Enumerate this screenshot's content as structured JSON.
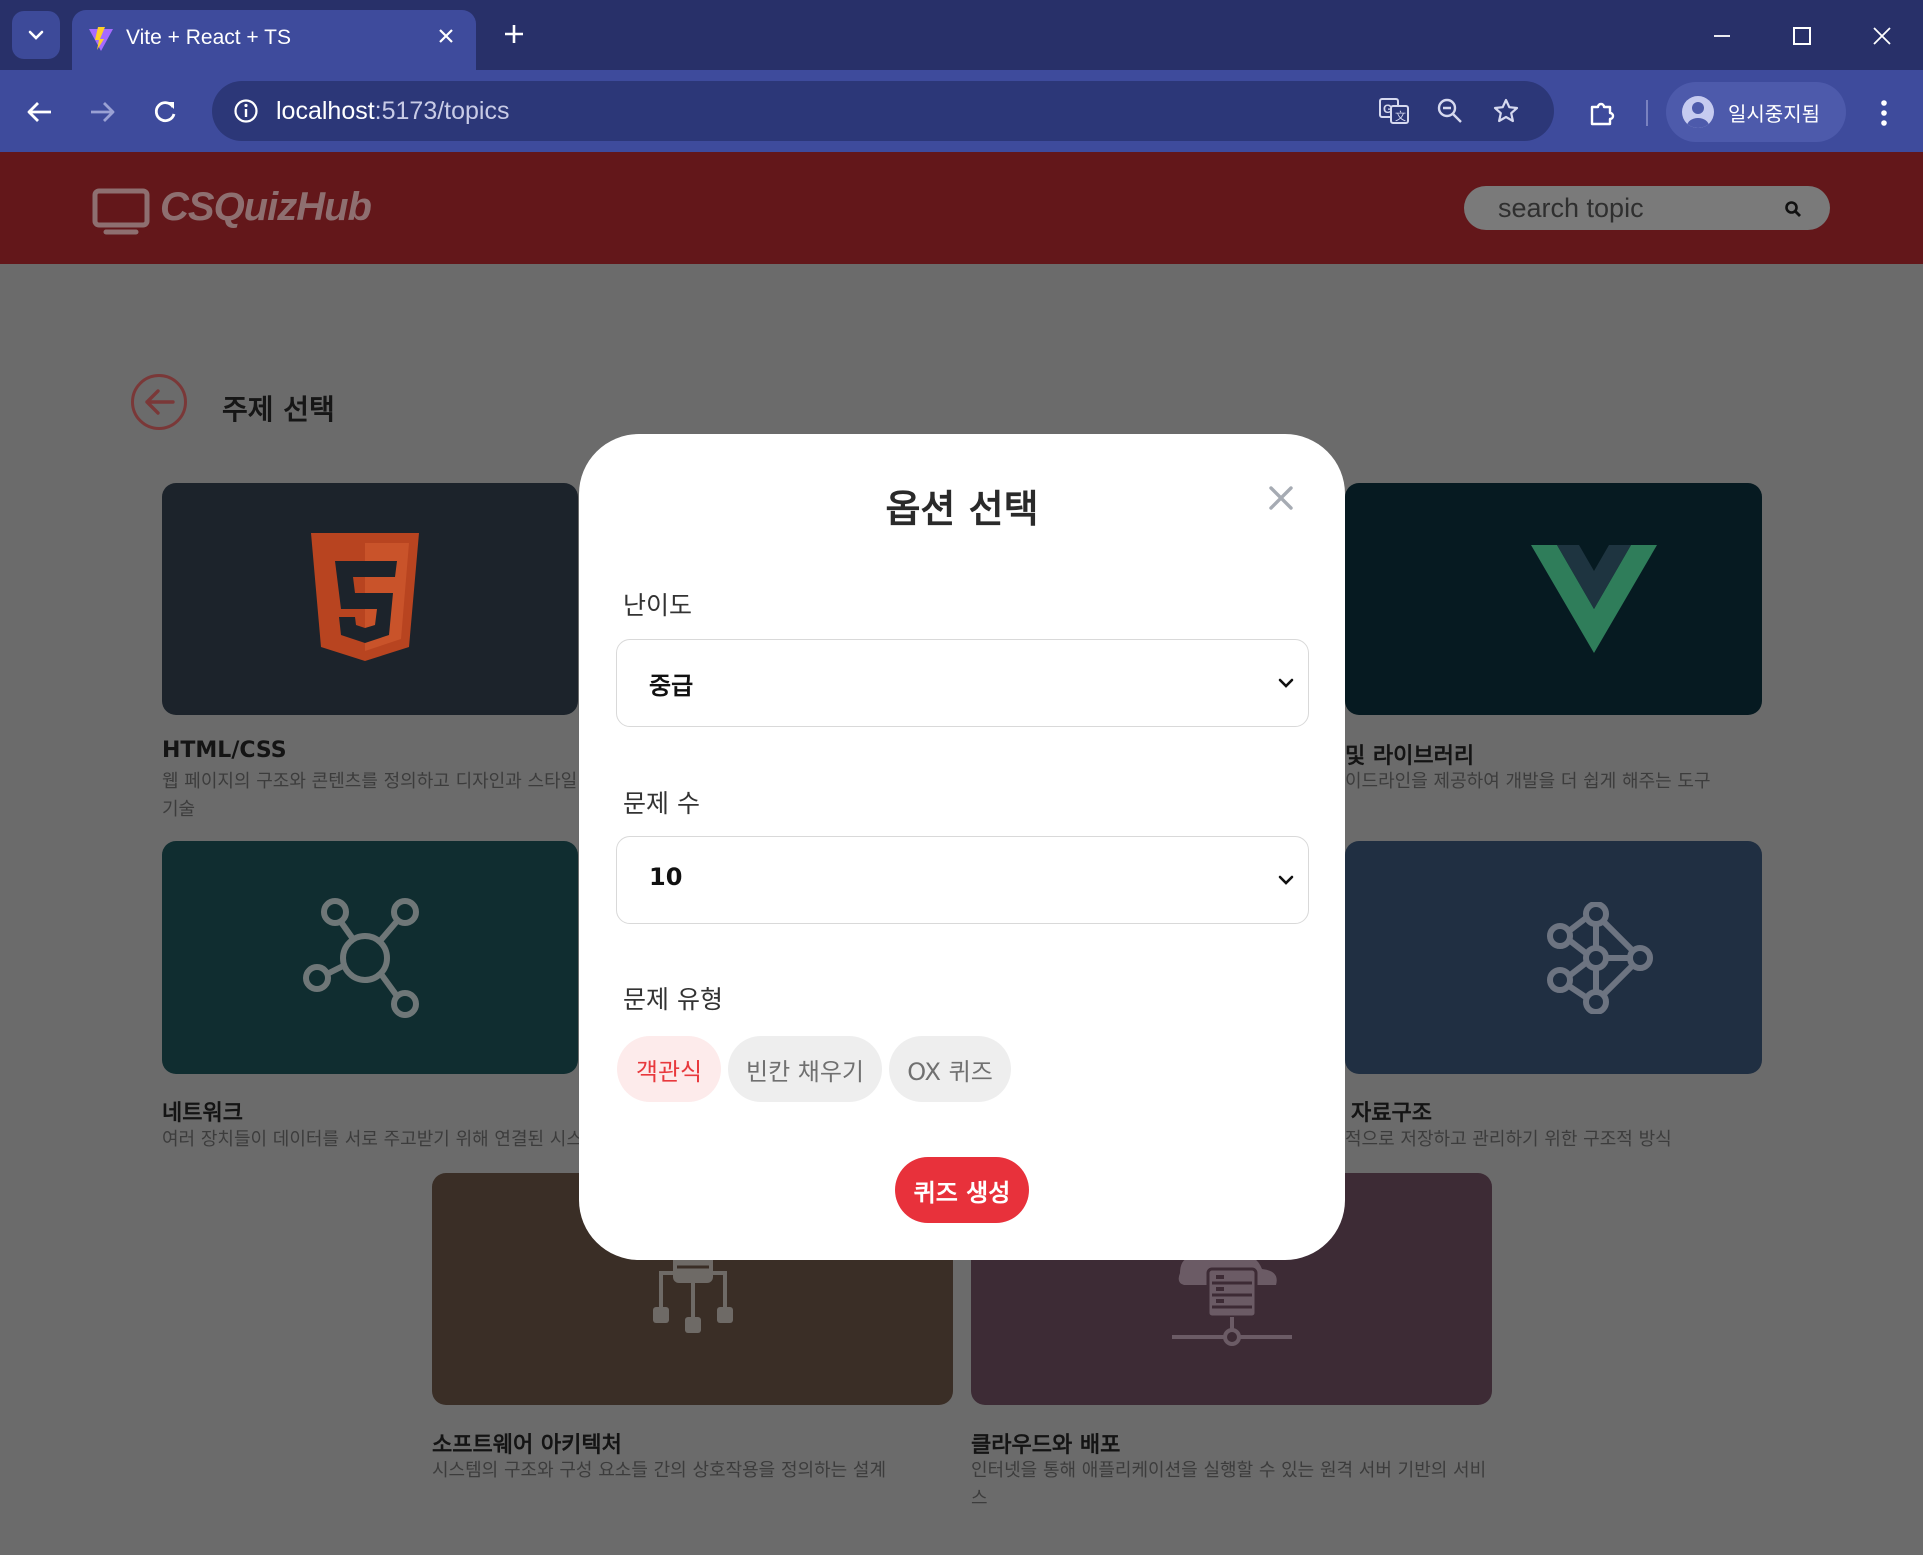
{
  "browser": {
    "tab_title": "Vite + React + TS",
    "url_host": "localhost",
    "url_rest": ":5173/topics",
    "profile_label": "일시중지됨"
  },
  "header": {
    "logo_text": "CSQuizHub",
    "search_placeholder": "search topic",
    "brand_color": "#63171a"
  },
  "page": {
    "title": "주제 선택"
  },
  "cards": [
    {
      "title": "HTML/CSS",
      "desc": "웹 페이지의 구조와 콘텐츠를 정의하고 디자인과 스타일",
      "desc2": "기술",
      "icon": "html5-icon",
      "bg": "#1c232b"
    },
    {
      "title": "및 라이브러리",
      "desc": "이드라인을 제공하여 개발을 더 쉽게 해주는 도구",
      "desc2": "",
      "icon": "vue-icon",
      "bg": "#061a21"
    },
    {
      "title": "네트워크",
      "desc": "여러 장치들이 데이터를 서로 주고받기 위해 연결된 시스",
      "desc2": "",
      "icon": "network-icon",
      "bg": "#102d30"
    },
    {
      "title": "자료구조",
      "desc": "적으로 저장하고 관리하기 위한 구조적 방식",
      "desc2": "",
      "icon": "data-structure-icon",
      "bg": "#202f42"
    },
    {
      "title": "소프트웨어 아키텍처",
      "desc": "시스템의 구조와 구성 요소들 간의 상호작용을 정의하는 설계",
      "desc2": "",
      "icon": "architecture-icon",
      "bg": "#3a2e26"
    },
    {
      "title": "클라우드와 배포",
      "desc": "인터넷을 통해 애플리케이션을 실행할 수 있는 원격 서버 기반의 서비",
      "desc2": "스",
      "icon": "cloud-server-icon",
      "bg": "#3d2b35"
    }
  ],
  "modal": {
    "title": "옵션 선택",
    "difficulty_label": "난이도",
    "difficulty_value": "중급",
    "count_label": "문제 수",
    "count_value": "10",
    "type_label": "문제 유형",
    "types": [
      "객관식",
      "빈칸 채우기",
      "OX 퀴즈"
    ],
    "selected_type": "객관식",
    "submit_label": "퀴즈 생성",
    "accent_color": "#e8313b"
  }
}
